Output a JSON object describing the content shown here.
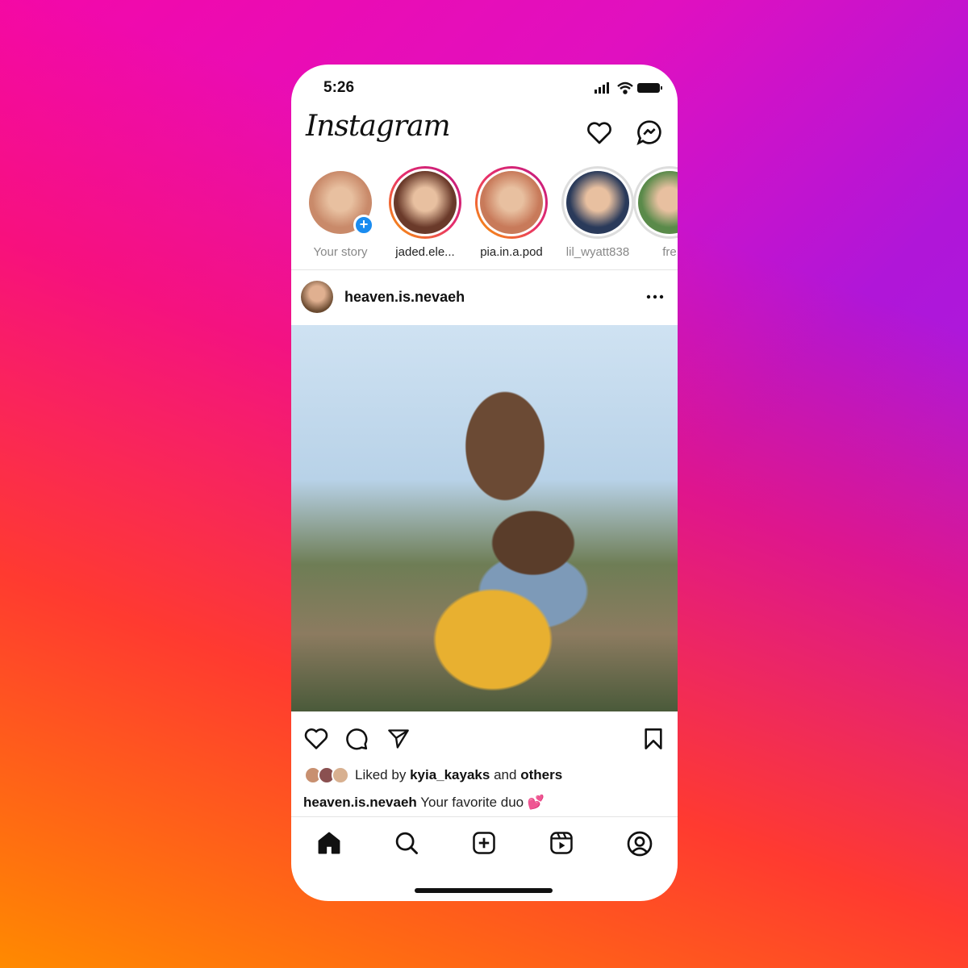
{
  "status_bar": {
    "time": "5:26",
    "icons": [
      "signal-icon",
      "wifi-icon",
      "battery-icon"
    ]
  },
  "header": {
    "logo": "Instagram",
    "icons": [
      "heart-icon",
      "messenger-icon"
    ]
  },
  "stories": [
    {
      "label": "Your story",
      "own": true,
      "color": "#c98a6a"
    },
    {
      "label": "jaded.ele...",
      "color": "#6a3a2a"
    },
    {
      "label": "pia.in.a.pod",
      "color": "#c87a5a"
    },
    {
      "label": "lil_wyatt838",
      "color": "#2a3a5a"
    },
    {
      "label": "fre",
      "color": "#5a8a4a"
    }
  ],
  "post": {
    "username": "heaven.is.nevaeh",
    "more_icon": "more-dots-icon",
    "liked_prefix": "Liked by",
    "liked_user": "kyia_kayaks",
    "liked_and": "and",
    "liked_others": "others",
    "caption_user": "heaven.is.nevaeh",
    "caption_text": "Your favorite duo 💕"
  },
  "bottom_nav": [
    "home-icon",
    "search-icon",
    "create-icon",
    "reels-icon",
    "profile-icon"
  ],
  "colors": {
    "story_ring_start": "#f8a000",
    "story_ring_end": "#c01880",
    "add_story": "#1a8cf0"
  }
}
